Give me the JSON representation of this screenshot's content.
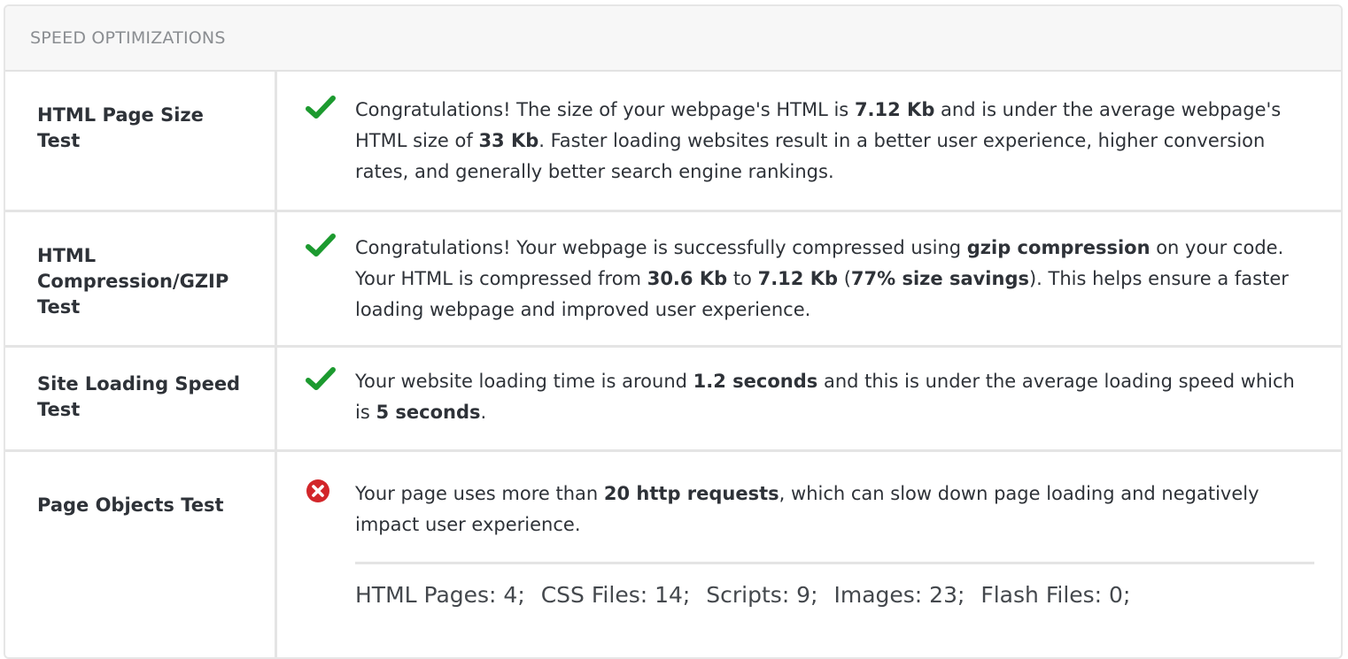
{
  "panel": {
    "title": "SPEED OPTIMIZATIONS"
  },
  "colors": {
    "pass": "#1c9a2f",
    "fail": "#d2262a"
  },
  "rows": [
    {
      "label": "HTML Page Size Test",
      "status": "pass",
      "icon": "checkmark-icon",
      "segments": [
        {
          "text": "Congratulations! The size of your webpage's HTML is ",
          "bold": false
        },
        {
          "text": "7.12 Kb",
          "bold": true
        },
        {
          "text": " and is under the average webpage's HTML size of ",
          "bold": false
        },
        {
          "text": "33 Kb",
          "bold": true
        },
        {
          "text": ". Faster loading websites result in a better user experience, higher conversion rates, and generally better search engine rankings.",
          "bold": false
        }
      ]
    },
    {
      "label": "HTML Compression/GZIP Test",
      "status": "pass",
      "icon": "checkmark-icon",
      "segments": [
        {
          "text": "Congratulations! Your webpage is successfully compressed using ",
          "bold": false
        },
        {
          "text": "gzip compression",
          "bold": true
        },
        {
          "text": " on your code. Your HTML is compressed from ",
          "bold": false
        },
        {
          "text": "30.6 Kb",
          "bold": true
        },
        {
          "text": " to ",
          "bold": false
        },
        {
          "text": "7.12 Kb",
          "bold": true
        },
        {
          "text": " (",
          "bold": false
        },
        {
          "text": "77% size savings",
          "bold": true
        },
        {
          "text": "). This helps ensure a faster loading webpage and improved user experience.",
          "bold": false
        }
      ]
    },
    {
      "label": "Site Loading Speed Test",
      "status": "pass",
      "icon": "checkmark-icon",
      "segments": [
        {
          "text": "Your website loading time is around ",
          "bold": false
        },
        {
          "text": "1.2 seconds",
          "bold": true
        },
        {
          "text": " and this is under the average loading speed which is ",
          "bold": false
        },
        {
          "text": "5 seconds",
          "bold": true
        },
        {
          "text": ".",
          "bold": false
        }
      ]
    },
    {
      "label": "Page Objects Test",
      "status": "fail",
      "icon": "error-x-icon",
      "segments": [
        {
          "text": "Your page uses more than ",
          "bold": false
        },
        {
          "text": "20 http requests",
          "bold": true
        },
        {
          "text": ", which can slow down page loading and negatively impact user experience.",
          "bold": false
        }
      ],
      "stats": [
        "HTML Pages: 4;",
        "CSS Files: 14;",
        "Scripts: 9;",
        "Images: 23;",
        "Flash Files: 0;"
      ]
    }
  ]
}
